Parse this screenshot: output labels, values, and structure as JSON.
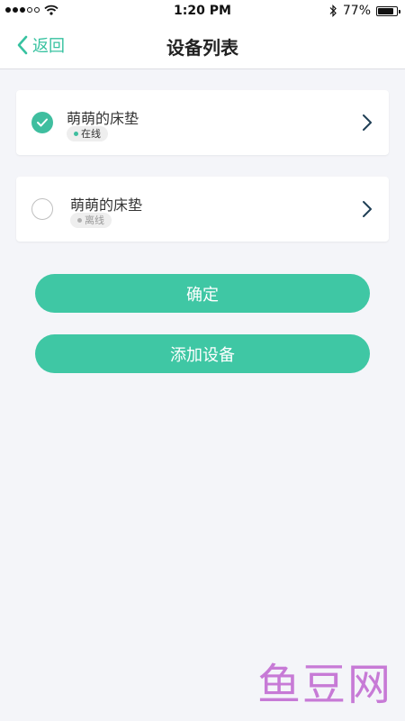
{
  "status_bar": {
    "time": "1:20 PM",
    "battery_percent": "77%",
    "battery_level": 0.77,
    "signal_dots_filled": 3,
    "signal_dots_total": 5
  },
  "nav": {
    "back_label": "返回",
    "title": "设备列表"
  },
  "devices": [
    {
      "name": "萌萌的床垫",
      "status": "在线",
      "selected": true
    },
    {
      "name": "萌萌的床垫",
      "status": "离线",
      "selected": false
    }
  ],
  "buttons": {
    "confirm_label": "确定",
    "add_device_label": "添加设备"
  },
  "watermark": "鱼豆网",
  "colors": {
    "accent": "#3fc7a4",
    "online_dot": "#3fbe9f",
    "offline_dot": "#b0b0b0",
    "background": "#f4f5f9",
    "watermark": "#c77ad6"
  },
  "icons": {
    "back": "chevron-left-icon",
    "row_arrow": "chevron-right-icon",
    "selected": "check-circle-icon",
    "wifi": "wifi-icon",
    "bluetooth": "bluetooth-icon",
    "battery": "battery-icon"
  }
}
